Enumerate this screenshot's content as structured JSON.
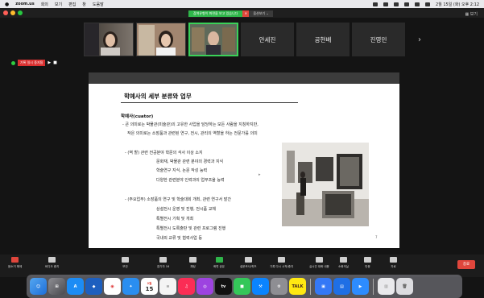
{
  "menubar": {
    "apple": "",
    "app": "zoom.us",
    "items": [
      "회의",
      "보기",
      "편집",
      "창",
      "도움말"
    ],
    "clock": "2월 15일 (화) 오후 2:12"
  },
  "share": {
    "status": "참여유형이 화면을 보고 있습니다",
    "view_options": "옵션보기 ⌄"
  },
  "window": {
    "gallery_label": "보기"
  },
  "participants": [
    {
      "name": "안세진"
    },
    {
      "name": "공현배"
    },
    {
      "name": "진영민"
    }
  ],
  "recording": {
    "label": "기록 일시 중지됨"
  },
  "slide": {
    "title": "학예사의 세부 분류와 업무",
    "subtitle": "학예사(cuator)",
    "lines": [
      "- 큰 의미로는 박물관(미술관)의 고유한 사업을 담당하는 모든 사람을 지칭하지만,",
      "작은 의미로는 소장품과 관련된 연구, 전시, 관리의 역할을 하는 전문가를 의미",
      "- (역      할) 관련 전공분야 학문의 석사 이상 소지",
      "문화재, 박물관 관련 분야의 경력과 지식",
      "학술연구 지식, 논문 작성 능력",
      "다양한 관련분야 인력과의 업무조율 능력",
      "- (주요업무) 소장품의 연구 및 학술대회 개최, 관련 연구서 발간",
      "상설전시 운영 및 진행, 전시품 교체",
      "특별전시 기획 및 개최",
      "특별전시 도록출판 및 관련 프로그램 진행",
      "국내외 교류 및 협력사업 등"
    ],
    "page": "7"
  },
  "toolbar": {
    "items": [
      {
        "label": "음소거 해제"
      },
      {
        "label": "비디오 중지"
      },
      {
        "label": "보안"
      },
      {
        "label": "참가자",
        "count": "16"
      },
      {
        "label": "채팅"
      },
      {
        "label": "화면 공유"
      },
      {
        "label": "설문조사/퀴즈"
      },
      {
        "label": "기록 다시 시작/중지"
      },
      {
        "label": "실시간 대화 내용"
      },
      {
        "label": "소회의실"
      },
      {
        "label": "반응"
      },
      {
        "label": "자료"
      }
    ],
    "end_label": "종료"
  },
  "dock": {
    "calendar_day": "15",
    "calendar_month": "2월",
    "apps": [
      "finder-icon",
      "launchpad-icon",
      "appstore-icon",
      "chrome-icon",
      "safari-icon",
      "calendar-icon",
      "notes-icon",
      "music-icon",
      "podcasts-icon",
      "tv-icon",
      "facetime-icon",
      "xcode-icon",
      "settings-icon",
      "kakaotalk-icon",
      "preview-icon",
      "keynote-icon",
      "zoom-icon",
      "document-icon",
      "trash-icon"
    ]
  },
  "colors": {
    "share_green": "#2fb64a",
    "end_red": "#e0463c",
    "active_speaker": "#3ad158"
  }
}
